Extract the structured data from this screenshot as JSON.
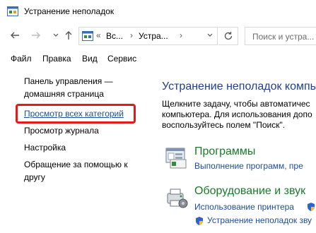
{
  "window": {
    "title": "Устранение неполадок"
  },
  "navigation": {
    "back_icon": "arrow-left-icon",
    "forward_icon": "arrow-right-icon",
    "recent_icon": "chevron-down-icon",
    "up_icon": "arrow-up-icon",
    "address": {
      "overflow": "«",
      "crumb1": "Вс...",
      "crumb2": "Устра..."
    },
    "refresh_icon": "refresh-icon",
    "search_placeholder": "Поиск и устра..."
  },
  "menu": {
    "items": [
      "Файл",
      "Правка",
      "Вид",
      "Сервис"
    ]
  },
  "sidebar": {
    "home_line1": "Панель управления —",
    "home_line2": "домашняя страница",
    "view_all": "Просмотр всех категорий",
    "view_history": "Просмотр журнала",
    "settings": "Настройка",
    "help_line1": "Обращение за помощью к",
    "help_line2": "другу"
  },
  "main": {
    "title": "Устранение неполадок компь",
    "desc_line1": "Щелкните задачу, чтобы автоматичес",
    "desc_line2": "компьютера. Для использования допо",
    "desc_line3": "воспользуйтесь полем \"Поиск\".",
    "categories": [
      {
        "title": "Программы",
        "icon": "programs-icon",
        "links": [
          "Выполнение программ, пре"
        ]
      },
      {
        "title": "Оборудование и звук",
        "icon": "hardware-sound-icon",
        "links": [
          "Использование принтера",
          "Устранение неполадок зву"
        ]
      }
    ]
  },
  "colors": {
    "link": "#1c4c9e",
    "heading": "#1e3e8f",
    "category": "#1b7a2a",
    "highlight": "#e21a1a"
  }
}
